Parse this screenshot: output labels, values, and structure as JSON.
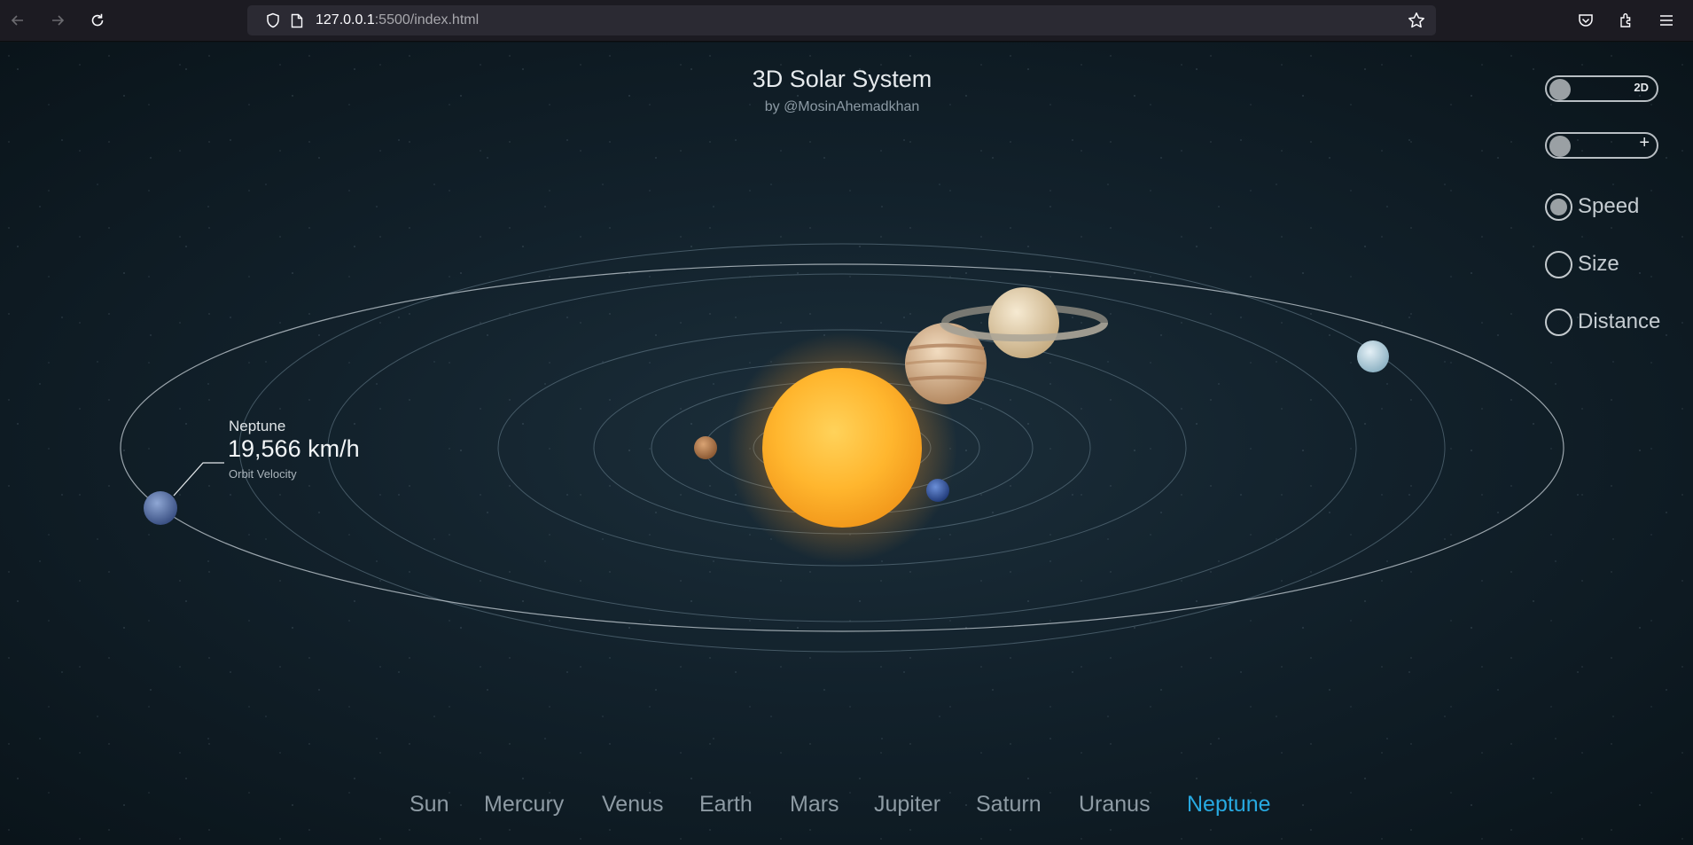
{
  "browser": {
    "url_host": "127.0.0.1",
    "url_rest": ":5500/index.html"
  },
  "header": {
    "title": "3D Solar System",
    "subtitle": "by @MosinAhemadkhan"
  },
  "controls": {
    "view_toggle_label": "2D",
    "zoom_toggle_label": "+",
    "scale_options": [
      {
        "label": "Speed",
        "selected": true
      },
      {
        "label": "Size",
        "selected": false
      },
      {
        "label": "Distance",
        "selected": false
      }
    ]
  },
  "info": {
    "planet_name": "Neptune",
    "value": "19,566 km/h",
    "caption": "Orbit Velocity"
  },
  "planet_nav": {
    "items": [
      {
        "label": "Sun"
      },
      {
        "label": "Mercury"
      },
      {
        "label": "Venus"
      },
      {
        "label": "Earth"
      },
      {
        "label": "Mars"
      },
      {
        "label": "Jupiter"
      },
      {
        "label": "Saturn"
      },
      {
        "label": "Uranus"
      },
      {
        "label": "Neptune"
      }
    ],
    "active": "Neptune"
  },
  "colors": {
    "active_accent": "#27a9e1",
    "sun": "#ffb62e",
    "background": "#12212b"
  }
}
